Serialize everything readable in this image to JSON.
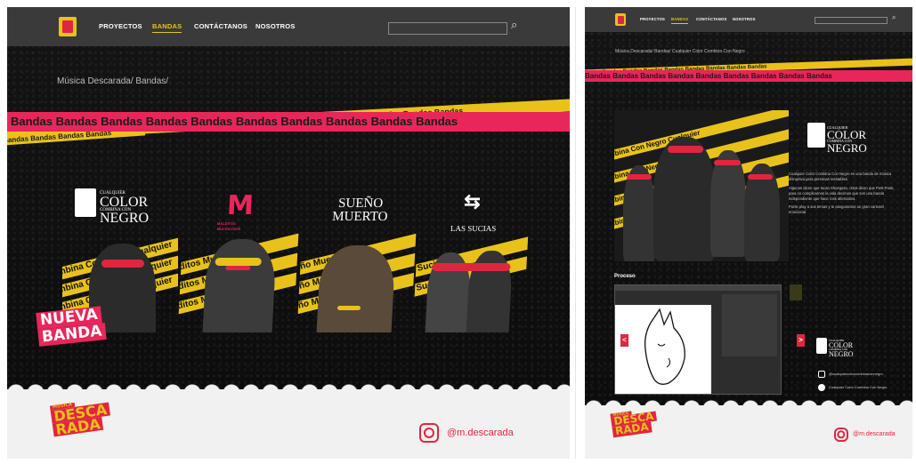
{
  "nav": {
    "links": [
      "PROYECTOS",
      "BANDAS",
      "CONTÁCTANOS",
      "NOSOTROS"
    ],
    "active": "BANDAS"
  },
  "page_a": {
    "breadcrumb": "Música Descarada/ Bandas/",
    "banner_text": "Bandas Bandas Bandas Bandas Bandas Bandas Bandas Bandas Bandas Bandas",
    "banner_back_text": "Bandas Bandas Bandas Bandas",
    "bands": [
      {
        "name_line1": "CUALQUIER",
        "name_line2": "COLOR",
        "name_line3": "COMBINA CON",
        "name_line4": "NEGRO",
        "stripe": "Combina Con Negro Cualquier"
      },
      {
        "name_line1": "MALDITOS",
        "name_line2": "MUCHACHOS",
        "stripe": "Malditos Muchachos"
      },
      {
        "name_line1": "SUEÑO",
        "name_line2": "MUERTO",
        "stripe": "Sueño Muerto"
      },
      {
        "name_line1": "LAS SUCIAS",
        "stripe": "Las Sucias"
      }
    ],
    "badge_line1": "NUEVA",
    "badge_line2": "BANDA"
  },
  "page_b": {
    "breadcrumb": "Música Descarada/ Bandas/ Cualquier Color Combina Con Negro",
    "banner_text": "Bandas Bandas Bandas Bandas Bandas Bandas Bandas Bandas Bandas",
    "stripe": "Combina Con Negro Cualquier",
    "band_logo": {
      "line1": "CUALQUIER",
      "line2": "COLOR",
      "line3": "COMBINA CON",
      "line4": "NEGRO"
    },
    "desc1": "Cualquier Color Combina Con Negro es una banda de música disruptiva para personas inestables.",
    "desc2": "Algunos dicen que tocan Shoegaze, otros dicen que Post-Punk, para no complicarnos la vida decimos que son una banda independiente que hace rock alternativo.",
    "desc3": "Ponle play a sus temas y te aseguramos un gran carrusel emocional.",
    "process_title": "Proceso",
    "social_ig": "@cualquiercolorcombinaconnegro",
    "social_spotify": "Cualquier Color Combina Con Negro",
    "arrow_left": "<",
    "arrow_right": ">"
  },
  "footer": {
    "logo_line1": "MÚSICA",
    "logo_line2": "DESCA",
    "logo_line3": "RADA",
    "instagram": "@m.descarada"
  },
  "icons": {
    "search": "search-icon",
    "instagram": "instagram-icon",
    "spotify": "spotify-icon"
  },
  "colors": {
    "accent_yellow": "#e8c21a",
    "accent_pink": "#e8265a",
    "accent_red": "#e0263f",
    "nav_bg": "#3a3a3a",
    "page_bg": "#0e0e0e"
  }
}
